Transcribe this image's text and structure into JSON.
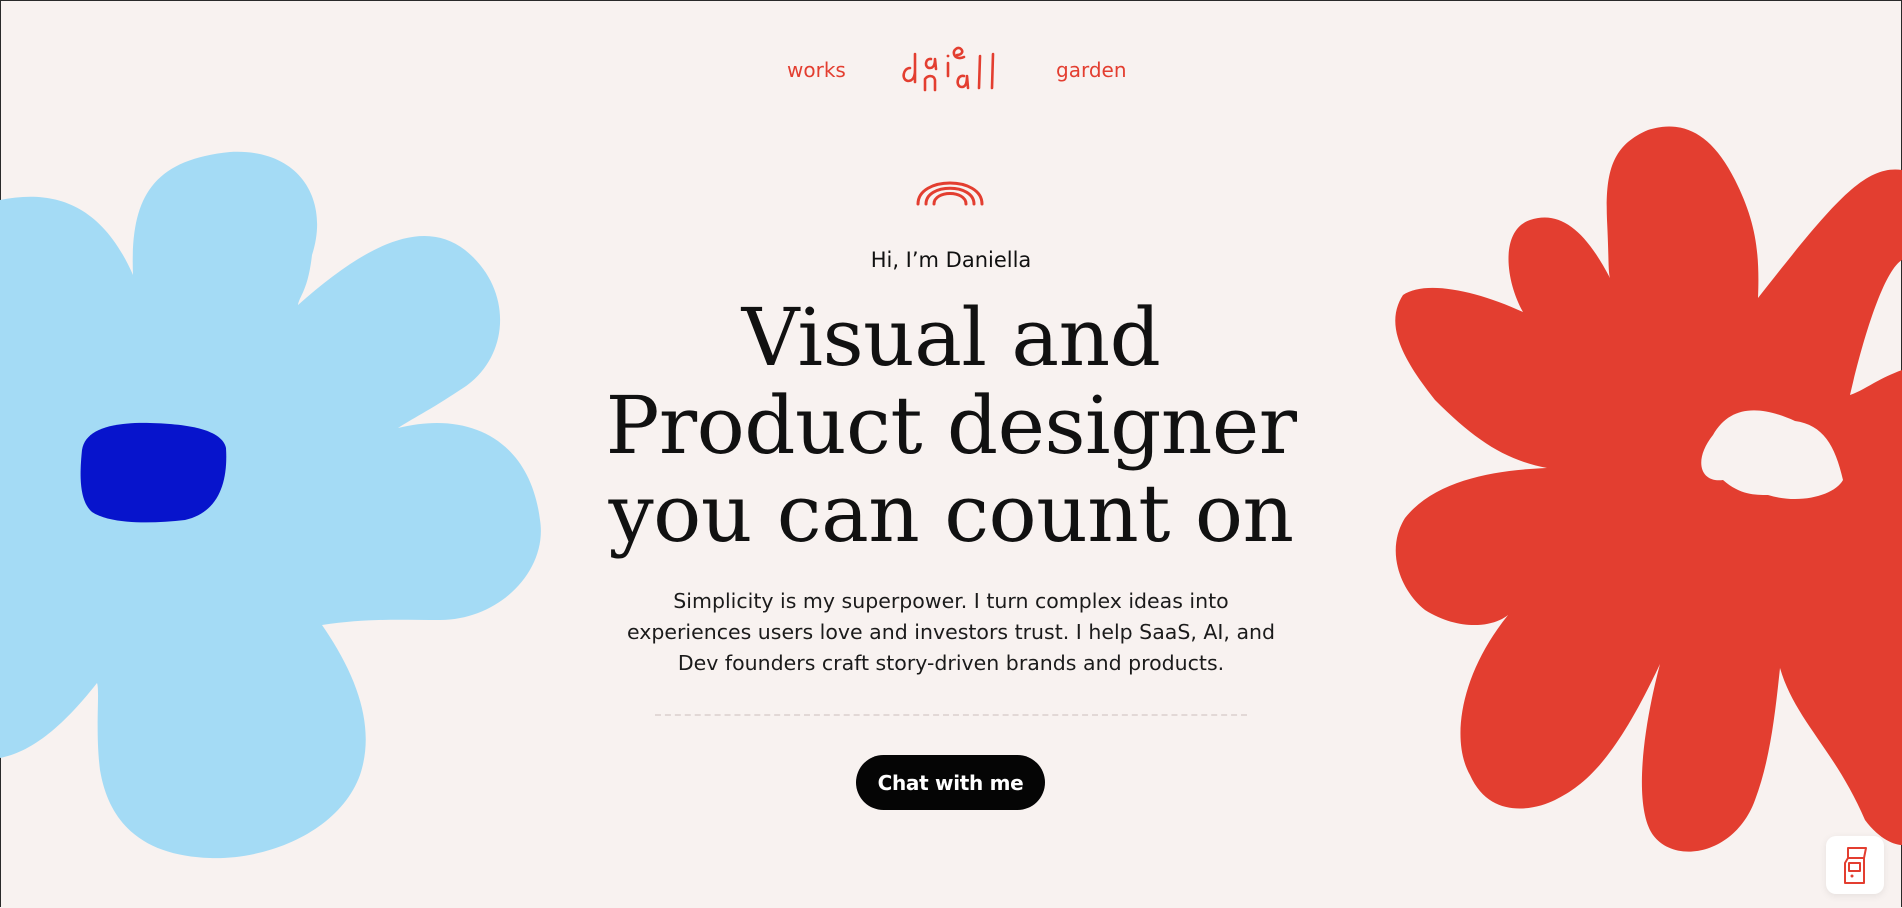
{
  "nav": {
    "works_label": "works",
    "garden_label": "garden",
    "logo_text": "daniell"
  },
  "hero": {
    "greeting": "Hi, I’m Daniella",
    "headline_line1": "Visual and",
    "headline_line2": "Product designer",
    "headline_line3": "you can count on",
    "subtext": "Simplicity is my superpower. I turn complex ideas into experiences users love and investors trust. I help SaaS, AI, and Dev founders craft story-driven brands and products.",
    "cta_label": "Chat with me"
  },
  "icons": {
    "rainbow": "rainbow-icon",
    "corner": "arcade-machine-icon"
  },
  "colors": {
    "background": "#f8f2f0",
    "accent_red": "#e33e30",
    "flower_blue": "#a4dbf5",
    "flower_center_blue": "#0714cc",
    "text": "#111111",
    "cta_bg": "#050505"
  }
}
